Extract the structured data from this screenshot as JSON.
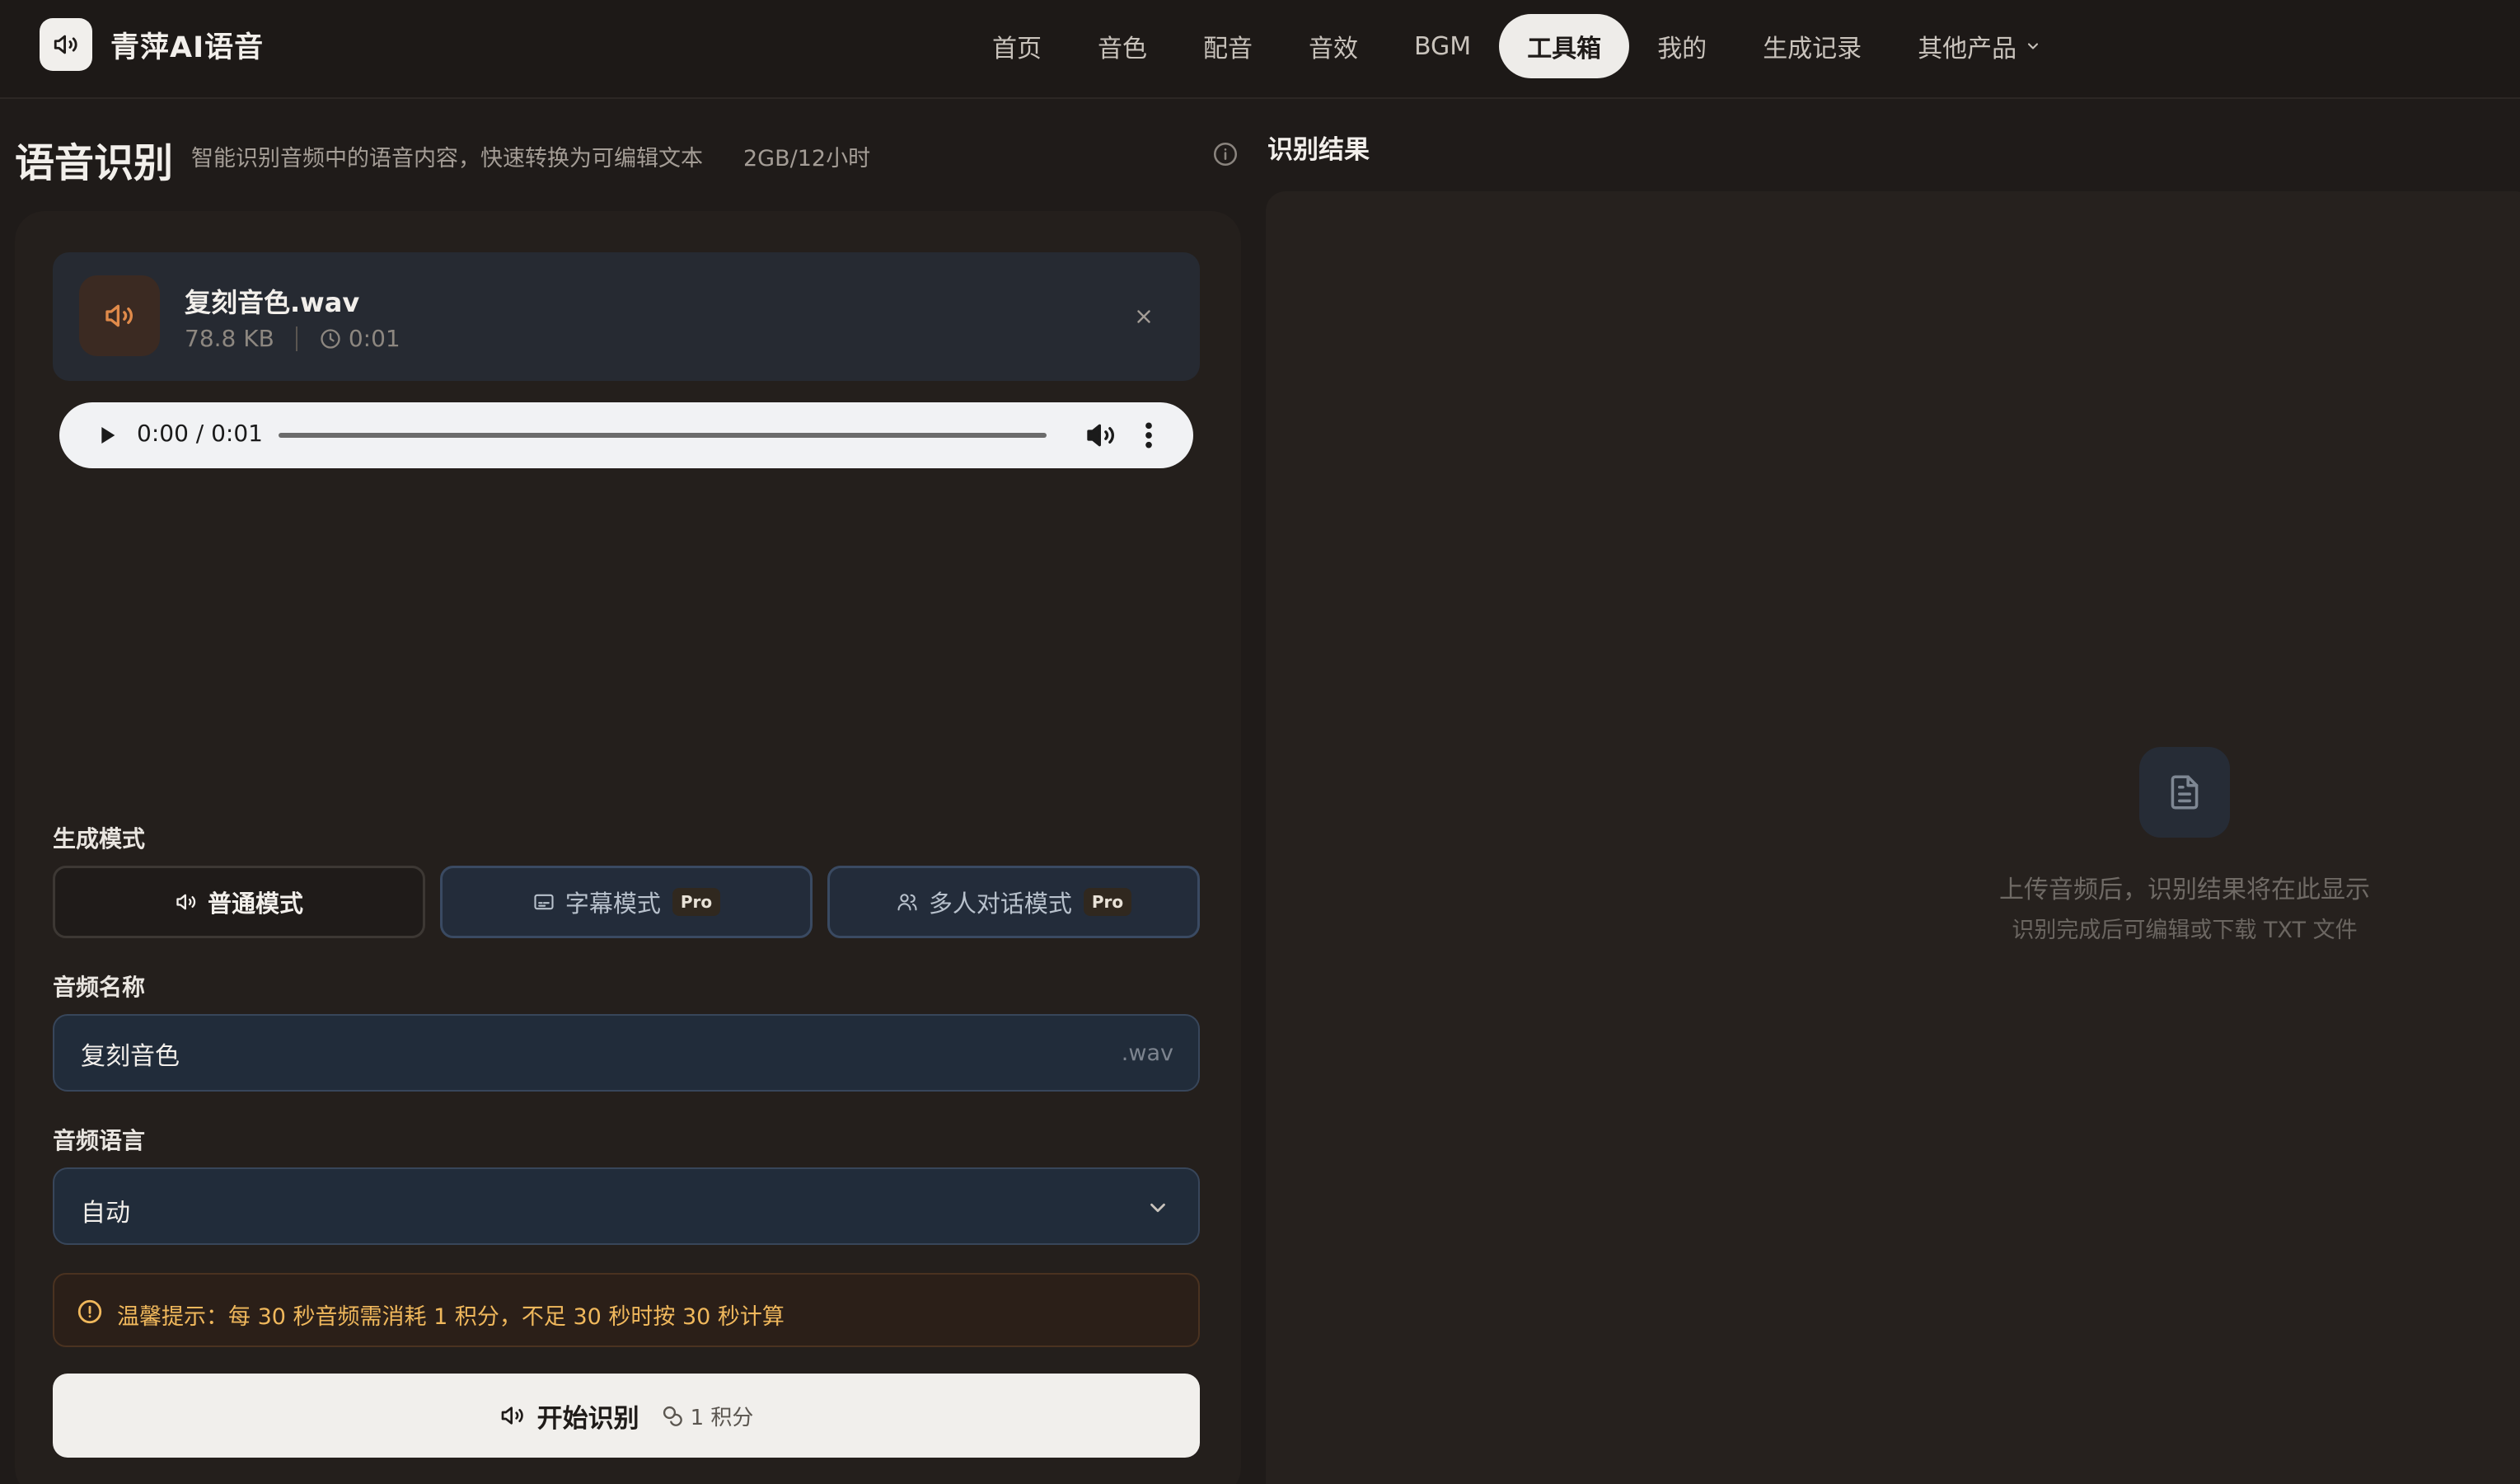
{
  "brand": {
    "name": "青萍AI语音"
  },
  "nav": {
    "items": [
      {
        "label": "首页"
      },
      {
        "label": "音色"
      },
      {
        "label": "配音"
      },
      {
        "label": "音效"
      },
      {
        "label": "BGM"
      },
      {
        "label": "工具箱",
        "active": true
      },
      {
        "label": "我的"
      },
      {
        "label": "生成记录"
      },
      {
        "label": "其他产品",
        "has_dropdown": true
      }
    ]
  },
  "page": {
    "title": "语音识别",
    "subtitle": "智能识别音频中的语音内容，快速转换为可编辑文本",
    "quota": "2GB/12小时"
  },
  "file": {
    "name": "复刻音色.wav",
    "size": "78.8 KB",
    "duration": "0:01"
  },
  "player": {
    "time": "0:00 / 0:01",
    "progress": 0
  },
  "mode": {
    "label": "生成模式",
    "options": [
      {
        "label": "普通模式",
        "selected": true,
        "icon": "speaker-icon"
      },
      {
        "label": "字幕模式",
        "badge": "Pro",
        "icon": "subtitle-icon"
      },
      {
        "label": "多人对话模式",
        "badge": "Pro",
        "icon": "users-icon"
      }
    ]
  },
  "audio_name": {
    "label": "音频名称",
    "value": "复刻音色",
    "suffix": ".wav"
  },
  "audio_lang": {
    "label": "音频语言",
    "value": "自动"
  },
  "notice": {
    "text": "温馨提示：每 30 秒音频需消耗 1 积分，不足 30 秒时按 30 秒计算"
  },
  "start": {
    "label": "开始识别",
    "cost": "1 积分"
  },
  "result": {
    "title": "识别结果",
    "empty_title": "上传音频后，识别结果将在此显示",
    "empty_sub": "识别完成后可编辑或下载 TXT 文件"
  },
  "colors": {
    "background": "#1f1b19",
    "accent_orange": "#e08a4a",
    "notice_text": "#f0b85c",
    "pro_border": "#3a4a62"
  }
}
